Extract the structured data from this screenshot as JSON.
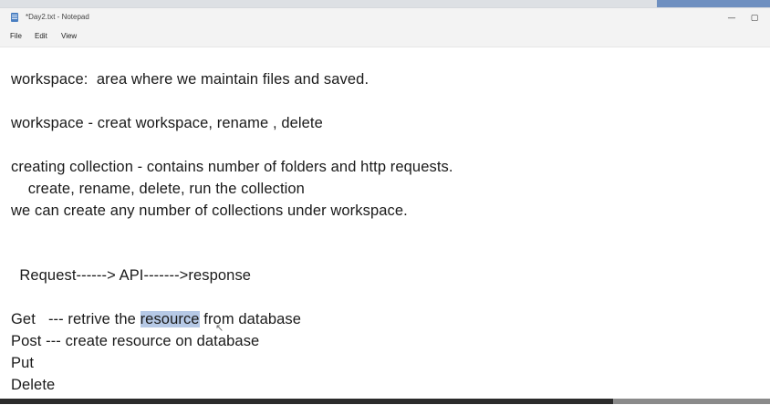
{
  "window": {
    "title": "*Day2.txt - Notepad",
    "minimize": "—",
    "maximize": "▢"
  },
  "menu": {
    "file": "File",
    "edit": "Edit",
    "view": "View"
  },
  "editor": {
    "line1": "workspace:  area where we maintain files and saved.",
    "line2": "workspace - creat workspace, rename , delete",
    "line3": "creating collection - contains number of folders and http requests.",
    "line4": "    create, rename, delete, run the collection",
    "line5": "we can create any number of collections under workspace.",
    "line6": "  Request------> API------->response",
    "line7_pre": "Get   --- retrive the ",
    "line7_sel": "resource",
    "line7_post": " from database",
    "line8": "Post --- create resource on database",
    "line9": "Put",
    "line10": "Delete"
  }
}
